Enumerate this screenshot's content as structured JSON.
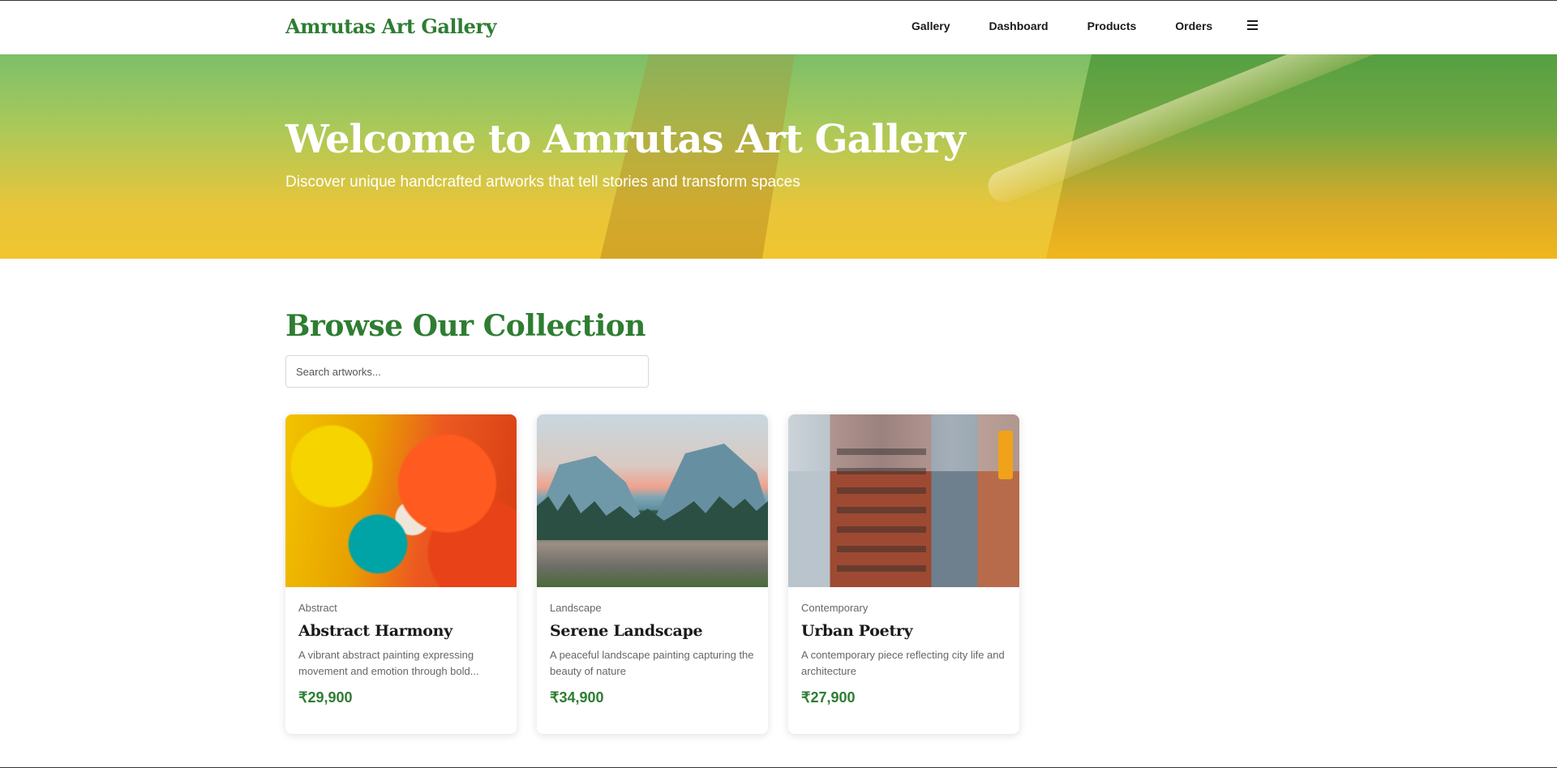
{
  "header": {
    "brand": "Amrutas Art Gallery",
    "nav": [
      "Gallery",
      "Dashboard",
      "Products",
      "Orders"
    ],
    "menu_icon": "hamburger-menu-icon"
  },
  "hero": {
    "title": "Welcome to Amrutas Art Gallery",
    "subtitle": "Discover unique handcrafted artworks that tell stories and transform spaces"
  },
  "collection": {
    "title": "Browse Our Collection",
    "search_placeholder": "Search artworks...",
    "search_value": "",
    "artworks": [
      {
        "category": "Abstract",
        "title": "Abstract Harmony",
        "description": "A vibrant abstract painting expressing movement and emotion through bold...",
        "price": "₹29,900"
      },
      {
        "category": "Landscape",
        "title": "Serene Landscape",
        "description": "A peaceful landscape painting capturing the beauty of nature",
        "price": "₹34,900"
      },
      {
        "category": "Contemporary",
        "title": "Urban Poetry",
        "description": "A contemporary piece reflecting city life and architecture",
        "price": "₹27,900"
      }
    ]
  },
  "colors": {
    "brand_green": "#2e7d32",
    "hero_top": "#7cbf6a",
    "hero_bottom": "#f1c52f"
  }
}
